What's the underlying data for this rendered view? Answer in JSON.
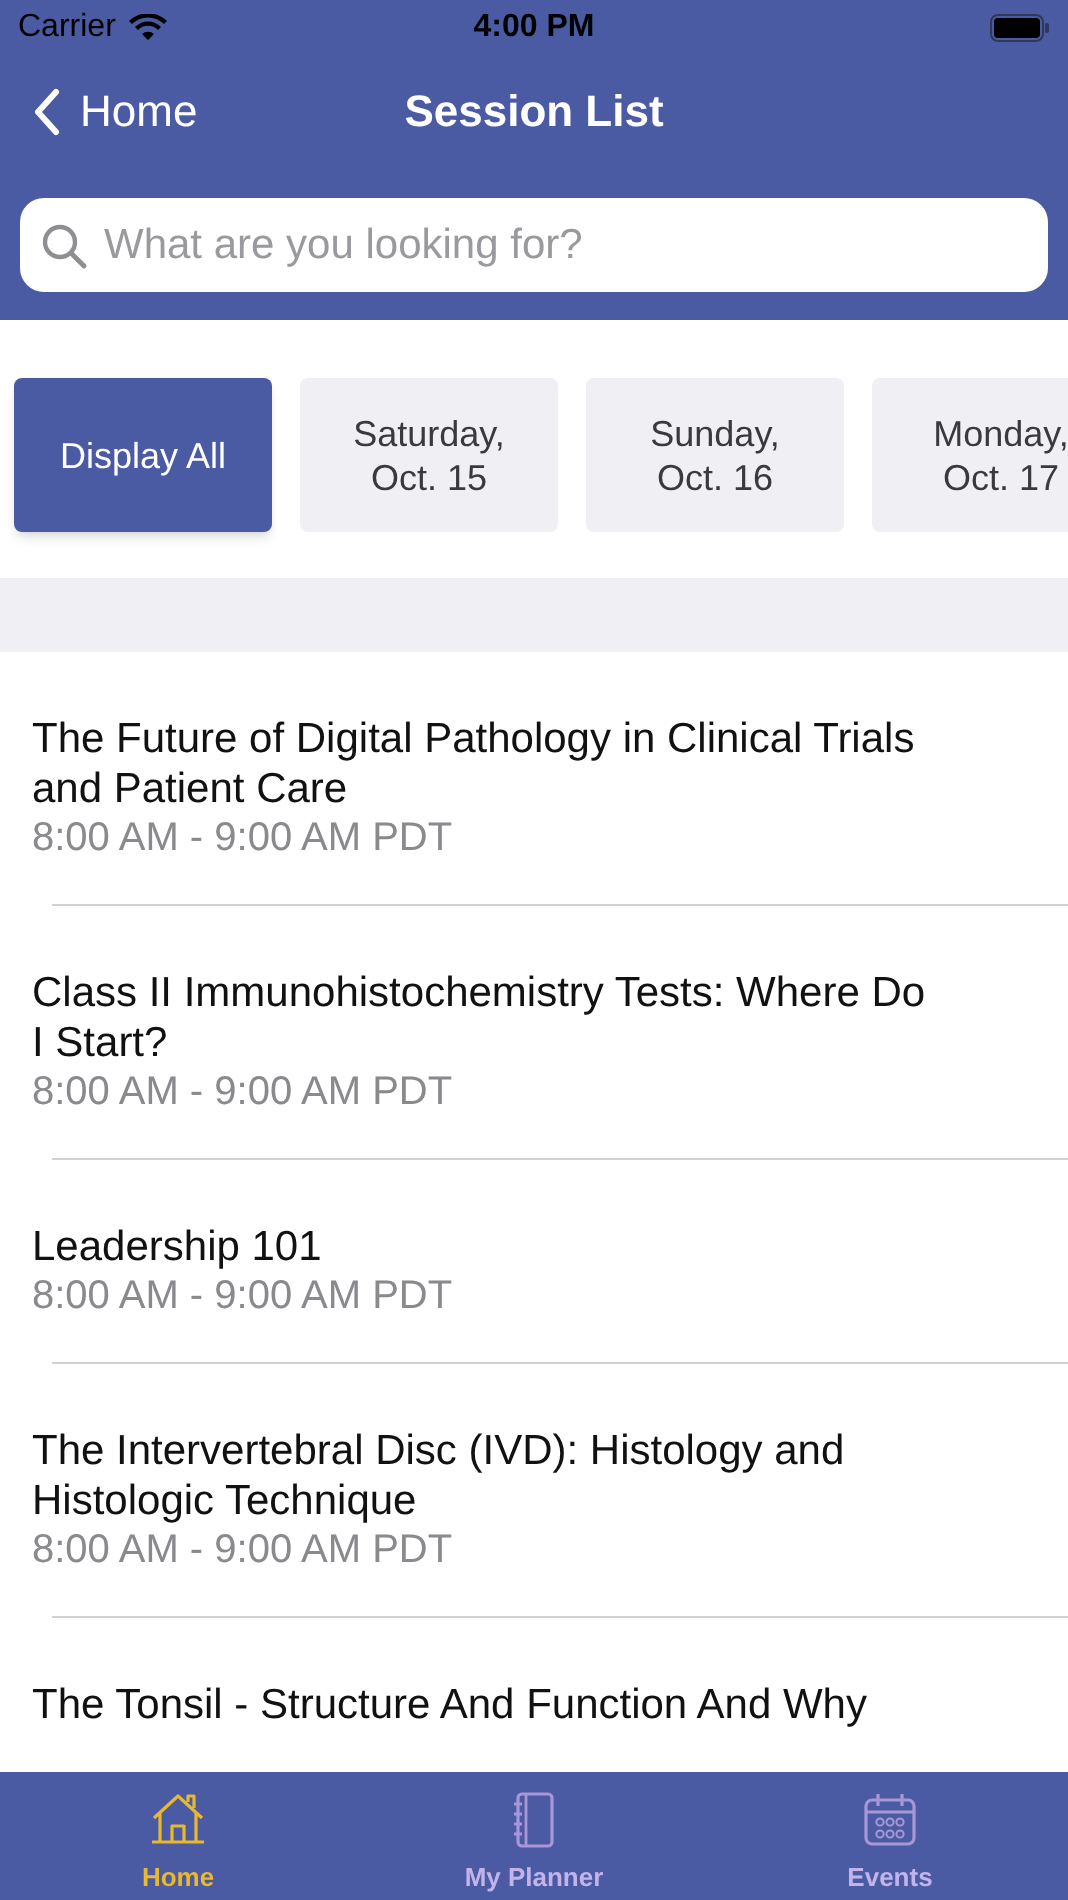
{
  "status_bar": {
    "carrier": "Carrier",
    "time": "4:00 PM"
  },
  "nav": {
    "back": "Home",
    "title": "Session List"
  },
  "search": {
    "placeholder": "What are you looking for?"
  },
  "day_filters": [
    {
      "label": "Display All",
      "selected": true
    },
    {
      "label": "Saturday,\nOct. 15",
      "selected": false
    },
    {
      "label": "Sunday,\nOct. 16",
      "selected": false
    },
    {
      "label": "Monday,\nOct. 17",
      "selected": false
    }
  ],
  "sessions": [
    {
      "title": "The Future of Digital Pathology in Clinical Trials and Patient Care",
      "time": "8:00 AM - 9:00 AM PDT"
    },
    {
      "title": "Class II Immunohistochemistry Tests: Where Do I Start?",
      "time": "8:00 AM - 9:00 AM PDT"
    },
    {
      "title": "Leadership 101",
      "time": "8:00 AM - 9:00 AM PDT"
    },
    {
      "title": "The Intervertebral Disc (IVD): Histology and Histologic Technique",
      "time": "8:00 AM - 9:00 AM PDT"
    },
    {
      "title": "The Tonsil - Structure And Function And Why"
    }
  ],
  "tab_bar": [
    {
      "kind": "home",
      "label": "Home",
      "selected": true
    },
    {
      "kind": "planner",
      "label": "My Planner",
      "selected": false
    },
    {
      "kind": "events",
      "label": "Events",
      "selected": false
    }
  ]
}
